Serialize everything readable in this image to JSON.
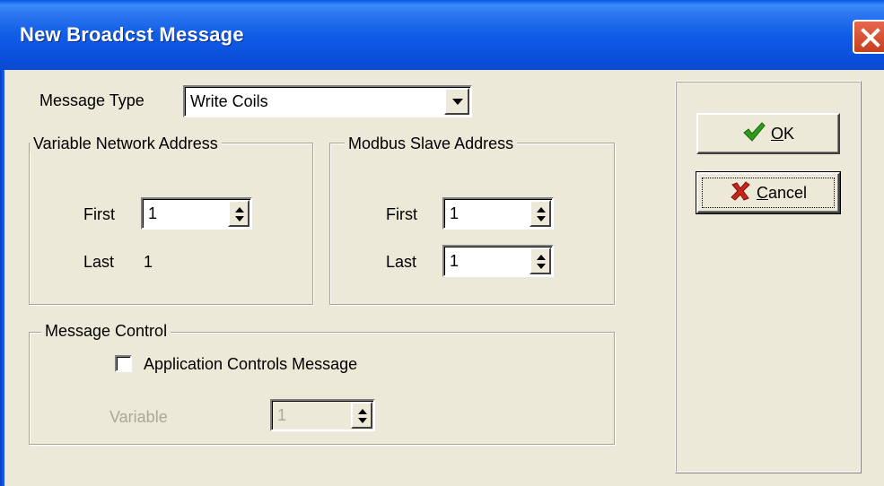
{
  "window": {
    "title": "New Broadcst Message",
    "close_icon": "close-icon"
  },
  "message_type": {
    "label": "Message Type",
    "value": "Write Coils"
  },
  "variable_network_address": {
    "title": "Variable Network Address",
    "first_label": "First",
    "first_value": "1",
    "last_label": "Last",
    "last_value": "1"
  },
  "modbus_slave_address": {
    "title": "Modbus Slave Address",
    "first_label": "First",
    "first_value": "1",
    "last_label": "Last",
    "last_value": "1"
  },
  "message_control": {
    "title": "Message Control",
    "checkbox_label": "Application Controls Message",
    "checkbox_checked": false,
    "variable_label": "Variable",
    "variable_value": "1"
  },
  "buttons": {
    "ok_mnemonic": "O",
    "ok_rest": "K",
    "ok_icon": "checkmark-icon",
    "cancel_mnemonic": "C",
    "cancel_rest": "ancel",
    "cancel_icon": "x-icon"
  },
  "colors": {
    "titlebar": "#0a4fdb",
    "face": "#ece9d8",
    "disabled_text": "#aca899",
    "ok_check": "#2f9a1a",
    "cancel_x": "#c8261a"
  }
}
